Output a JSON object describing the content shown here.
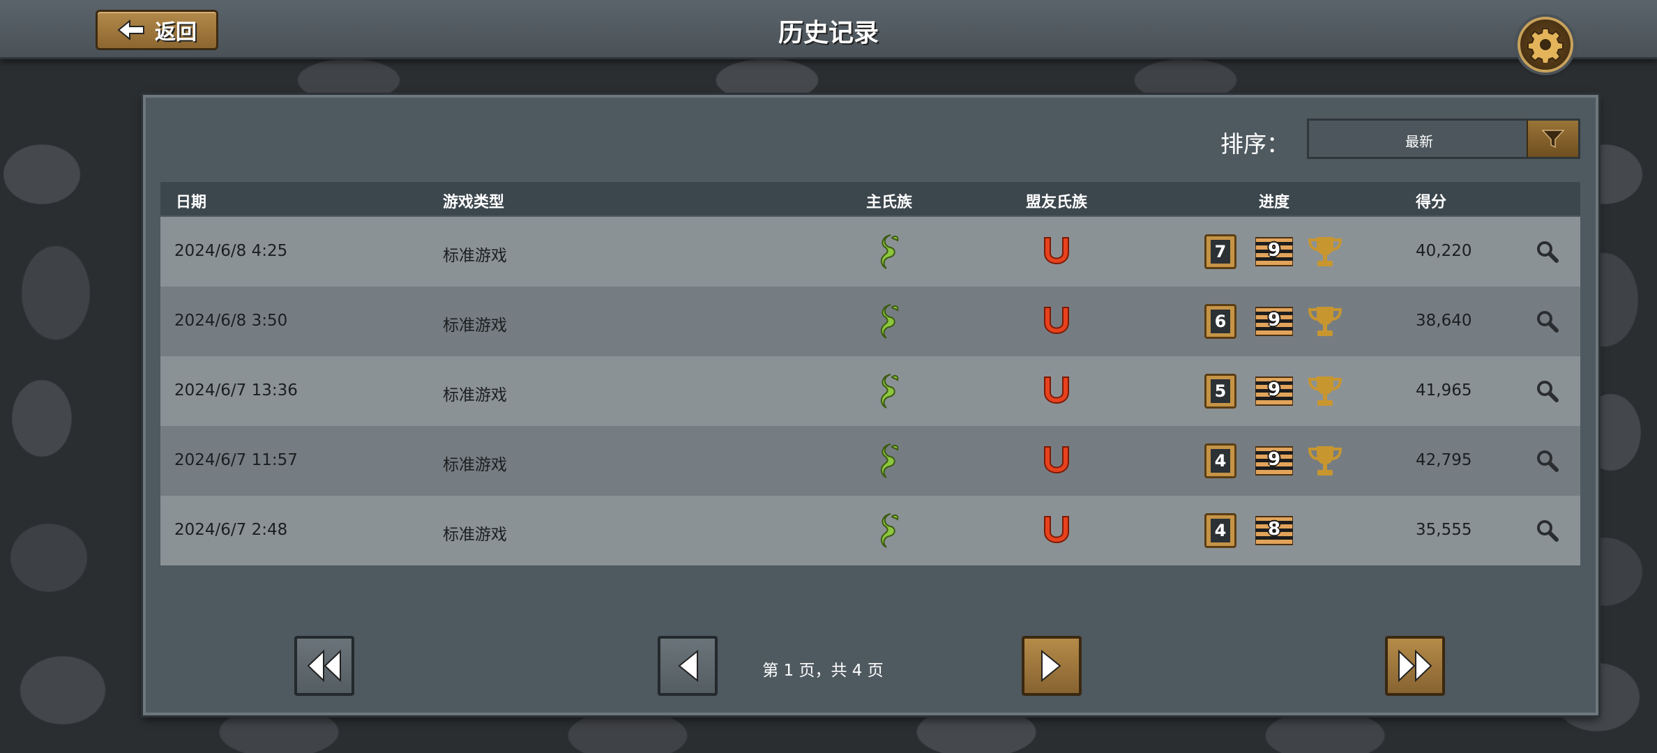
{
  "header": {
    "back_label": "返回",
    "title": "历史记录"
  },
  "sort": {
    "label": "排序：",
    "value": "最新"
  },
  "table": {
    "columns": [
      "日期",
      "游戏类型",
      "主氏族",
      "盟友氏族",
      "进度",
      "得分"
    ],
    "rows": [
      {
        "date": "2024/6/8 4:25",
        "type": "标准游戏",
        "level": "7",
        "stripes": "9",
        "trophy": true,
        "score": "40,220"
      },
      {
        "date": "2024/6/8 3:50",
        "type": "标准游戏",
        "level": "6",
        "stripes": "9",
        "trophy": true,
        "score": "38,640"
      },
      {
        "date": "2024/6/7 13:36",
        "type": "标准游戏",
        "level": "5",
        "stripes": "9",
        "trophy": true,
        "score": "41,965"
      },
      {
        "date": "2024/6/7 11:57",
        "type": "标准游戏",
        "level": "4",
        "stripes": "9",
        "trophy": true,
        "score": "42,795"
      },
      {
        "date": "2024/6/7 2:48",
        "type": "标准游戏",
        "level": "4",
        "stripes": "8",
        "trophy": false,
        "score": "35,555"
      }
    ]
  },
  "pagination": {
    "page_info": "第 1 页，共 4 页"
  },
  "icons": {
    "main_clan": "green-leaf-clan-icon",
    "ally_clan": "red-horseshoe-clan-icon",
    "level_badge": "level-badge-icon",
    "stripes": "striped-banner-icon",
    "trophy": "trophy-icon",
    "view": "magnifier-icon"
  },
  "colors": {
    "main_clan": "#8cc63f",
    "ally_clan": "#e8411d",
    "gold": "#c8962f"
  }
}
